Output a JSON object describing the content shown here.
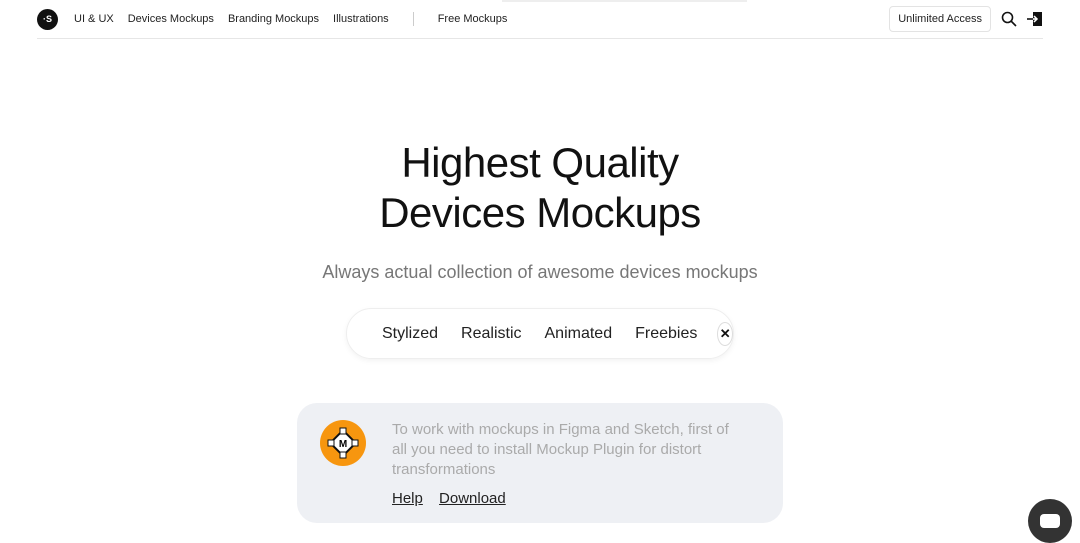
{
  "nav": {
    "logo": "·S",
    "items": [
      "UI & UX",
      "Devices Mockups",
      "Branding Mockups",
      "Illustrations"
    ],
    "free": "Free Mockups",
    "unlimited": "Unlimited Access"
  },
  "hero": {
    "title_line1": "Highest Quality",
    "title_line2": "Devices Mockups",
    "subtitle": "Always actual collection of awesome devices mockups"
  },
  "filters": [
    "Stylized",
    "Realistic",
    "Animated",
    "Freebies"
  ],
  "notice": {
    "text": "To work with mockups in Figma and Sketch, first of all you need to install Mockup Plugin for distort transformations",
    "help": "Help",
    "download": "Download",
    "badge_color": "#f7960f"
  }
}
